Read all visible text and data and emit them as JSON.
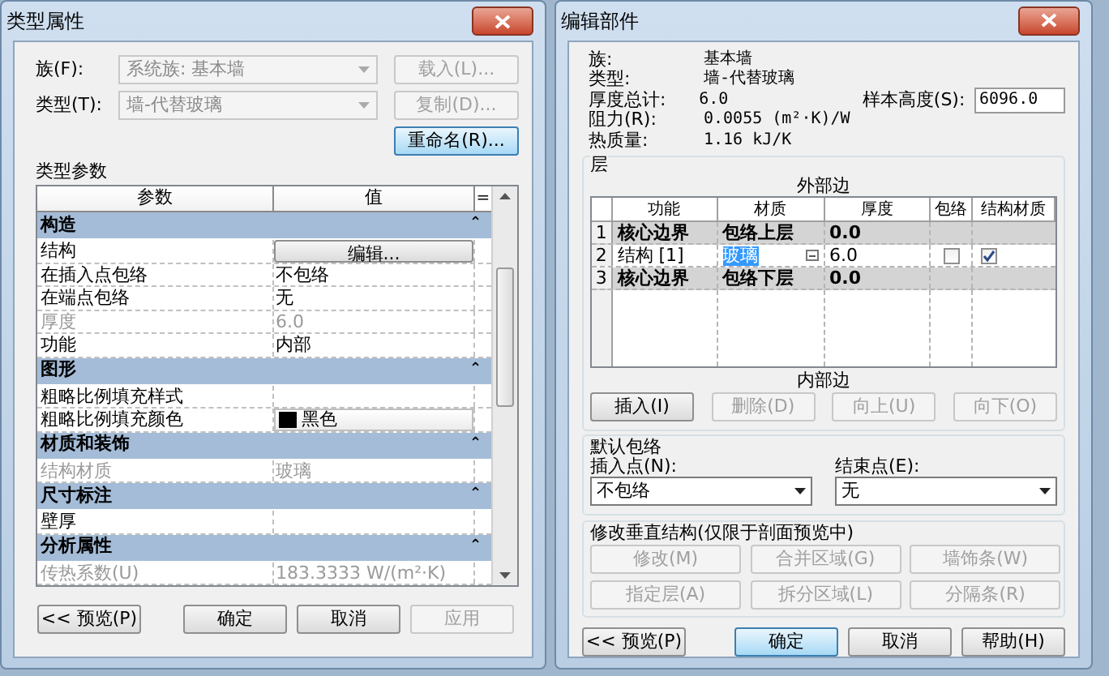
{
  "left_window": {
    "title": "类型属性",
    "family": {
      "label": "族(F):",
      "value": "系统族: 基本墙"
    },
    "type": {
      "label": "类型(T):",
      "value": "墙-代替玻璃"
    },
    "side_buttons": [
      {
        "label": "载入(L)...",
        "disabled": true,
        "focused": false
      },
      {
        "label": "复制(D)...",
        "disabled": true,
        "focused": false
      },
      {
        "label": "重命名(R)...",
        "disabled": false,
        "focused": true
      }
    ],
    "section_label": "类型参数",
    "table": {
      "columns": [
        "参数",
        "值",
        "="
      ],
      "rows": [
        {
          "kind": "group",
          "label": "构造",
          "toggle": "⌃"
        },
        {
          "kind": "button",
          "label": "结构",
          "value": "编辑...",
          "disabled": false
        },
        {
          "kind": "text",
          "label": "在插入点包络",
          "value": "不包络",
          "disabled": false
        },
        {
          "kind": "text",
          "label": "在端点包络",
          "value": "无",
          "disabled": false
        },
        {
          "kind": "text",
          "label": "厚度",
          "value": "6.0",
          "disabled": true
        },
        {
          "kind": "text",
          "label": "功能",
          "value": "内部",
          "disabled": false
        },
        {
          "kind": "group",
          "label": "图形",
          "toggle": "⌃"
        },
        {
          "kind": "text",
          "label": "粗略比例填充样式",
          "disabled": false
        },
        {
          "kind": "swatch",
          "label": "粗略比例填充颜色",
          "value": "黑色",
          "disabled": false
        },
        {
          "kind": "group",
          "label": "材质和装饰",
          "toggle": "⌃"
        },
        {
          "kind": "text",
          "label": "结构材质",
          "value": "玻璃",
          "disabled": true
        },
        {
          "kind": "group",
          "label": "尺寸标注",
          "toggle": "⌃"
        },
        {
          "kind": "text",
          "label": "壁厚",
          "disabled": false
        },
        {
          "kind": "group",
          "label": "分析属性",
          "toggle": "⌃"
        },
        {
          "kind": "text",
          "label": "传热系数(U)",
          "value": "183.3333 W/(m²·K)",
          "disabled": true
        }
      ]
    },
    "buttons": [
      {
        "label": "<< 预览(P)",
        "disabled": false,
        "focused": false
      },
      {
        "label": "确定",
        "disabled": false,
        "focused": false
      },
      {
        "label": "取消",
        "disabled": false,
        "focused": false
      },
      {
        "label": "应用",
        "disabled": true,
        "focused": false
      }
    ]
  },
  "right_window": {
    "title": "编辑部件",
    "info": [
      {
        "label": "族:",
        "value": "基本墙"
      },
      {
        "label": "类型:",
        "value": "墙-代替玻璃"
      },
      {
        "label": "厚度总计:",
        "value": "6.0"
      },
      {
        "label": "阻力(R):",
        "value": "0.0055 (m²·K)/W"
      },
      {
        "label": "热质量:",
        "value": "1.16 kJ/K"
      }
    ],
    "sample_height": {
      "label": "样本高度(S):",
      "value": "6096.0"
    },
    "layers": {
      "title": "层",
      "exterior_label": "外部边",
      "interior_label": "内部边",
      "columns": [
        "功能",
        "材质",
        "厚度",
        "包络",
        "结构材质"
      ],
      "rows": [
        {
          "kind": "boundary",
          "index": "1",
          "function": "核心边界",
          "material": "包络上层",
          "thickness": "0.0"
        },
        {
          "kind": "layer",
          "index": "2",
          "function": "结构 [1]",
          "material": "玻璃",
          "material_selected": true,
          "thickness": "6.0",
          "wrap": false,
          "structural": true
        },
        {
          "kind": "boundary",
          "index": "3",
          "function": "核心边界",
          "material": "包络下层",
          "thickness": "0.0"
        }
      ],
      "buttons": [
        {
          "label": "插入(I)",
          "disabled": false,
          "focused": false
        },
        {
          "label": "删除(D)",
          "disabled": true,
          "focused": false
        },
        {
          "label": "向上(U)",
          "disabled": true,
          "focused": false
        },
        {
          "label": "向下(O)",
          "disabled": true,
          "focused": false
        }
      ]
    },
    "default_wrapping": {
      "title": "默认包络",
      "insert": {
        "label": "插入点(N):",
        "value": "不包络"
      },
      "end": {
        "label": "结束点(E):",
        "value": "无"
      }
    },
    "vertical_structure": {
      "title": "修改垂直结构(仅限于剖面预览中)",
      "buttons": [
        {
          "label": "修改(M)",
          "disabled": true,
          "focused": false
        },
        {
          "label": "合并区域(G)",
          "disabled": true,
          "focused": false
        },
        {
          "label": "墙饰条(W)",
          "disabled": true,
          "focused": false
        },
        {
          "label": "指定层(A)",
          "disabled": true,
          "focused": false
        },
        {
          "label": "拆分区域(L)",
          "disabled": true,
          "focused": false
        },
        {
          "label": "分隔条(R)",
          "disabled": true,
          "focused": false
        }
      ]
    },
    "buttons": [
      {
        "label": "<< 预览(P)",
        "disabled": false,
        "focused": false
      },
      {
        "label": "确定",
        "disabled": false,
        "focused": true
      },
      {
        "label": "取消",
        "disabled": false,
        "focused": false
      },
      {
        "label": "帮助(H)",
        "disabled": false,
        "focused": false
      }
    ]
  }
}
